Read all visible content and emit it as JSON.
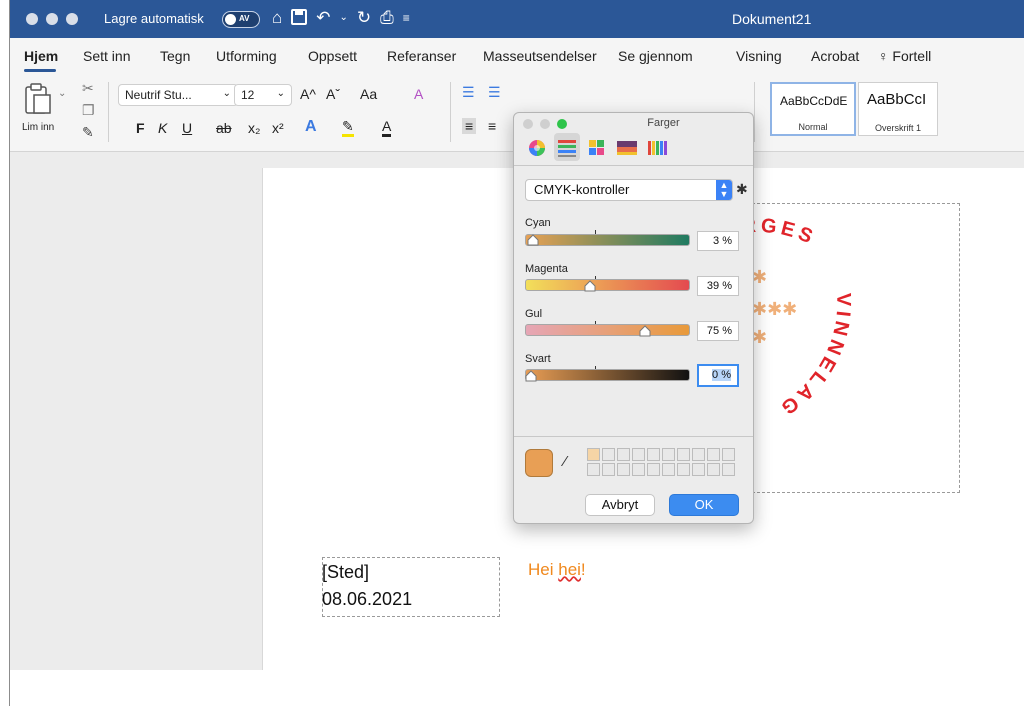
{
  "window": {
    "autosave_label": "Lagre automatisk",
    "autosave_toggle": "AV",
    "document_title": "Dokument21"
  },
  "ribbon_tabs": [
    "Hjem",
    "Sett inn",
    "Tegn",
    "Utforming",
    "Oppsett",
    "Referanser",
    "Masseutsendelser",
    "Se gjennom",
    "Visning",
    "Acrobat",
    "Fortell"
  ],
  "ribbon": {
    "paste_label": "Lim inn",
    "font_name": "Neutrif Stu...",
    "font_size": "12",
    "grow_font": "A^",
    "shrink_font": "Aˇ",
    "change_case": "Aa",
    "bold": "F",
    "italic": "K",
    "underline": "U",
    "strike": "ab",
    "subscript": "x₂",
    "superscript": "x²",
    "styles": [
      {
        "sample": "AaBbCcDdE",
        "name": "Normal"
      },
      {
        "sample": "AaBbCcI",
        "name": "Overskrift 1"
      }
    ]
  },
  "document": {
    "place": "[Sted]",
    "date": "08.06.2021",
    "greeting_start": "Hei ",
    "greeting_word": "hei",
    "greeting_end": "!",
    "stamp_text_upper": "RGES",
    "stamp_text_right": "VINNELAG",
    "stamp_color": "#e0242a"
  },
  "color_dialog": {
    "title": "Farger",
    "mode_icons": [
      "color-wheel-icon",
      "sliders-icon",
      "palette-icon",
      "image-palette-icon",
      "crayons-icon"
    ],
    "mode_selected": "CMYK-kontroller",
    "sliders": [
      {
        "label": "Cyan",
        "value_text": "3 %",
        "value": 3
      },
      {
        "label": "Magenta",
        "value_text": "39 %",
        "value": 39
      },
      {
        "label": "Gul",
        "value_text": "75 %",
        "value": 75
      },
      {
        "label": "Svart",
        "value_text": "0 %",
        "value": 0
      }
    ],
    "current_color": "#e89f55",
    "cancel_label": "Avbryt",
    "ok_label": "OK"
  },
  "colors": {
    "titlebar": "#2b5797",
    "accent": "#3c8cf0",
    "greeting": "#f0891e"
  }
}
